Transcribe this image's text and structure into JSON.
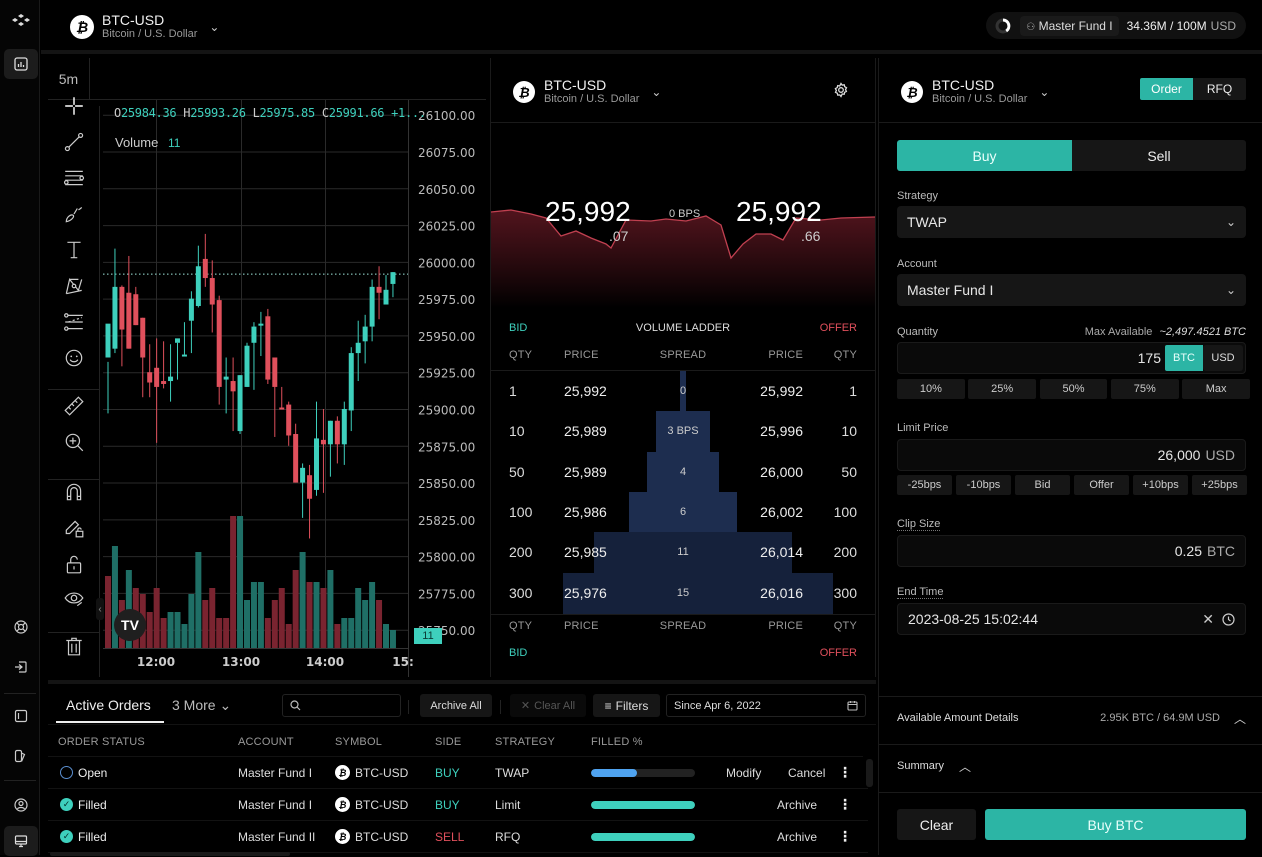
{
  "app": {
    "colors": {
      "accent": "#2cb5a5",
      "buy": "#3ed0bd",
      "sell": "#e0505c",
      "open_status": "#5b8fd0",
      "bg": "#000000",
      "ladder_fill": "#1b2a4a",
      "progress_partial": "#4fa3f0",
      "progress_full": "#3ed0bd"
    }
  },
  "leftrail": {
    "icons": [
      "logo-icon",
      "chart-icon",
      "support-icon",
      "logout-icon",
      "layout-icon",
      "theme-icon",
      "user-icon",
      "monitor-icon"
    ]
  },
  "topbar": {
    "symbol": "BTC-USD",
    "symbol_sub": "Bitcoin / U.S. Dollar",
    "coin_glyph": "₿",
    "fund_label": "Master Fund I",
    "fund_usage": "34.36M / 100M",
    "fund_currency": "USD"
  },
  "chart": {
    "interval": "5m",
    "ohlc": {
      "o_label": "O",
      "o": "25984.36",
      "h_label": "H",
      "h": "25993.26",
      "l_label": "L",
      "l": "25975.85",
      "c_label": "C",
      "c": "25991.66",
      "change": "+1..."
    },
    "volume_label": "Volume",
    "volume_value": "11",
    "volume_badge": "11",
    "logo_text": "TV",
    "tools": [
      "crosshair-icon",
      "trendline-icon",
      "fib-icon",
      "brush-icon",
      "text-icon",
      "pattern-icon",
      "forecast-icon",
      "emoji-icon",
      "ruler-icon",
      "zoom-in-icon",
      "magnet-icon",
      "lock-draw-icon",
      "lock-icon",
      "eye-icon",
      "trash-icon"
    ]
  },
  "chart_data": {
    "type": "candlestick",
    "title": "BTC-USD 5m",
    "y_ticks": [
      "26100.00",
      "26075.00",
      "26050.00",
      "26025.00",
      "26000.00",
      "25975.00",
      "25950.00",
      "25925.00",
      "25900.00",
      "25875.00",
      "25850.00",
      "25825.00",
      "25800.00",
      "25775.00",
      "25750.00"
    ],
    "ylim": [
      25743,
      26110
    ],
    "x_ticks": [
      "12:00",
      "13:00",
      "14:00",
      "15:"
    ],
    "last_price": 25991.66,
    "candles": [
      [
        25935,
        25958,
        25897,
        25932
      ],
      [
        25941,
        25983,
        25938,
        26009
      ],
      [
        25983,
        25954,
        25929,
        25984
      ],
      [
        25979,
        25941,
        25941,
        26004
      ],
      [
        25978,
        25957,
        25957,
        25983
      ],
      [
        25962,
        25935,
        25908,
        25962
      ],
      [
        25925,
        25918,
        25908,
        25944
      ],
      [
        25928,
        25915,
        25877,
        25948
      ],
      [
        25919,
        25917,
        25914,
        25946
      ],
      [
        25919,
        25922,
        25905,
        25944
      ],
      [
        25945,
        25948,
        25920,
        25945
      ],
      [
        25937,
        25937,
        25937,
        25959
      ],
      [
        25960,
        25975,
        25938,
        25980
      ],
      [
        25970,
        25997,
        25969,
        26011
      ],
      [
        26002,
        25989,
        25983,
        26019
      ],
      [
        25989,
        25971,
        25952,
        26001
      ],
      [
        25974,
        25915,
        25903,
        25977
      ],
      [
        25920,
        25922,
        25897,
        25935
      ],
      [
        25919,
        25912,
        25885,
        25935
      ],
      [
        25885,
        25923,
        25883,
        25923
      ],
      [
        25915,
        25943,
        25915,
        25945
      ],
      [
        25945,
        25956,
        25913,
        25959
      ],
      [
        25958,
        25958,
        25936,
        25966
      ],
      [
        25963,
        25920,
        25917,
        25968
      ],
      [
        25935,
        25915,
        25881,
        25935
      ],
      [
        25901,
        25900,
        25900,
        25915
      ],
      [
        25903,
        25882,
        25875,
        25905
      ],
      [
        25883,
        25850,
        25850,
        25890
      ],
      [
        25850,
        25860,
        25826,
        25863
      ],
      [
        25855,
        25839,
        25812,
        25862
      ],
      [
        25845,
        25880,
        25841,
        25905
      ],
      [
        25879,
        25876,
        25843,
        25900
      ],
      [
        25876,
        25892,
        25854,
        25892
      ],
      [
        25892,
        25876,
        25863,
        25895
      ],
      [
        25876,
        25900,
        25862,
        25905
      ],
      [
        25899,
        25938,
        25885,
        25942
      ],
      [
        25938,
        25945,
        25919,
        25960
      ],
      [
        25946,
        25956,
        25931,
        25964
      ],
      [
        25956,
        25983,
        25946,
        25988
      ],
      [
        25983,
        25979,
        25961,
        25997
      ],
      [
        25971,
        25981,
        25971,
        25991
      ],
      [
        25985,
        25993,
        25976,
        25993
      ]
    ],
    "volumes": [
      {
        "v": 12,
        "d": "down"
      },
      {
        "v": 17,
        "d": "up"
      },
      {
        "v": 8,
        "d": "down"
      },
      {
        "v": 13,
        "d": "up"
      },
      {
        "v": 10,
        "d": "down"
      },
      {
        "v": 9,
        "d": "down"
      },
      {
        "v": 6,
        "d": "down"
      },
      {
        "v": 10,
        "d": "down"
      },
      {
        "v": 5,
        "d": "down"
      },
      {
        "v": 6,
        "d": "up"
      },
      {
        "v": 6,
        "d": "up"
      },
      {
        "v": 4,
        "d": "up"
      },
      {
        "v": 9,
        "d": "up"
      },
      {
        "v": 16,
        "d": "up"
      },
      {
        "v": 8,
        "d": "down"
      },
      {
        "v": 10,
        "d": "down"
      },
      {
        "v": 5,
        "d": "down"
      },
      {
        "v": 5,
        "d": "down"
      },
      {
        "v": 22,
        "d": "down"
      },
      {
        "v": 22,
        "d": "up"
      },
      {
        "v": 8,
        "d": "up"
      },
      {
        "v": 11,
        "d": "up"
      },
      {
        "v": 11,
        "d": "up"
      },
      {
        "v": 5,
        "d": "down"
      },
      {
        "v": 8,
        "d": "down"
      },
      {
        "v": 10,
        "d": "down"
      },
      {
        "v": 4,
        "d": "down"
      },
      {
        "v": 13,
        "d": "down"
      },
      {
        "v": 16,
        "d": "up"
      },
      {
        "v": 11,
        "d": "down"
      },
      {
        "v": 11,
        "d": "up"
      },
      {
        "v": 10,
        "d": "down"
      },
      {
        "v": 13,
        "d": "up"
      },
      {
        "v": 4,
        "d": "down"
      },
      {
        "v": 5,
        "d": "up"
      },
      {
        "v": 5,
        "d": "up"
      },
      {
        "v": 10,
        "d": "up"
      },
      {
        "v": 8,
        "d": "up"
      },
      {
        "v": 11,
        "d": "up"
      },
      {
        "v": 8,
        "d": "down"
      },
      {
        "v": 4,
        "d": "up"
      },
      {
        "v": 3,
        "d": "up"
      }
    ]
  },
  "ladder": {
    "symbol": "BTC-USD",
    "symbol_sub": "Bitcoin / U.S. Dollar",
    "bid_big": "25,992",
    "bid_small": ".07",
    "spread_bps": "0 BPS",
    "offer_big": "25,992",
    "offer_small": ".66",
    "bid_label": "BID",
    "title": "VOLUME LADDER",
    "offer_label": "OFFER",
    "headers": [
      "QTY",
      "PRICE",
      "SPREAD",
      "PRICE",
      "QTY"
    ],
    "rows": [
      {
        "bid_qty": "1",
        "bid_price": "25,992",
        "spread": "0",
        "offer_price": "25,992",
        "offer_qty": "1",
        "depth": 0.02
      },
      {
        "bid_qty": "10",
        "bid_price": "25,989",
        "spread": "3 BPS",
        "offer_price": "25,996",
        "offer_qty": "10",
        "depth": 0.2
      },
      {
        "bid_qty": "50",
        "bid_price": "25,989",
        "spread": "4",
        "offer_price": "26,000",
        "offer_qty": "50",
        "depth": 0.27
      },
      {
        "bid_qty": "100",
        "bid_price": "25,986",
        "spread": "6",
        "offer_price": "26,002",
        "offer_qty": "100",
        "depth": 0.4
      },
      {
        "bid_qty": "200",
        "bid_price": "25,985",
        "spread": "11",
        "offer_price": "26,014",
        "offer_qty": "200",
        "depth": 0.73
      },
      {
        "bid_qty": "300",
        "bid_price": "25,976",
        "spread": "15",
        "offer_price": "26,016",
        "offer_qty": "300",
        "depth": 1.0
      }
    ],
    "footer_headers": [
      "QTY",
      "PRICE",
      "SPREAD",
      "PRICE",
      "QTY"
    ],
    "footer_bid": "BID",
    "footer_offer": "OFFER"
  },
  "order_form": {
    "symbol": "BTC-USD",
    "symbol_sub": "Bitcoin / U.S. Dollar",
    "mode_tabs": [
      "Order",
      "RFQ"
    ],
    "side_tabs": [
      "Buy",
      "Sell"
    ],
    "strategy_label": "Strategy",
    "strategy_value": "TWAP",
    "account_label": "Account",
    "account_value": "Master Fund I",
    "quantity_label": "Quantity",
    "max_available_label": "Max Available",
    "max_available_value": "~2,497.4521 BTC",
    "quantity_value": "175",
    "qty_units": [
      "BTC",
      "USD"
    ],
    "qty_presets": [
      "10%",
      "25%",
      "50%",
      "75%",
      "Max"
    ],
    "limit_label": "Limit Price",
    "limit_value": "26,000",
    "limit_unit": "USD",
    "limit_presets": [
      "-25bps",
      "-10bps",
      "Bid",
      "Offer",
      "+10bps",
      "+25bps"
    ],
    "clip_label": "Clip Size",
    "clip_value": "0.25",
    "clip_unit": "BTC",
    "end_label": "End Time",
    "end_value": "2023-08-25 15:02:44",
    "available_label": "Available Amount Details",
    "available_value": "2.95K BTC / 64.9M USD",
    "summary_label": "Summary",
    "clear_label": "Clear",
    "submit_label": "Buy BTC"
  },
  "orders": {
    "tab_active": "Active Orders",
    "tab_more": "3 More",
    "search_placeholder": "",
    "archive_all": "Archive All",
    "clear_all": "Clear All",
    "filters": "Filters",
    "date_filter": "Since Apr 6, 2022",
    "headers": [
      "ORDER STATUS",
      "ACCOUNT",
      "SYMBOL",
      "SIDE",
      "STRATEGY",
      "FILLED %"
    ],
    "rows": [
      {
        "status": "Open",
        "account": "Master Fund I",
        "symbol": "BTC-USD",
        "side": "BUY",
        "strategy": "TWAP",
        "filled": 0.44,
        "actions": [
          "Modify",
          "Cancel"
        ]
      },
      {
        "status": "Filled",
        "account": "Master Fund I",
        "symbol": "BTC-USD",
        "side": "BUY",
        "strategy": "Limit",
        "filled": 1.0,
        "actions": [
          "Archive"
        ]
      },
      {
        "status": "Filled",
        "account": "Master Fund II",
        "symbol": "BTC-USD",
        "side": "SELL",
        "strategy": "RFQ",
        "filled": 1.0,
        "actions": [
          "Archive"
        ]
      }
    ]
  }
}
